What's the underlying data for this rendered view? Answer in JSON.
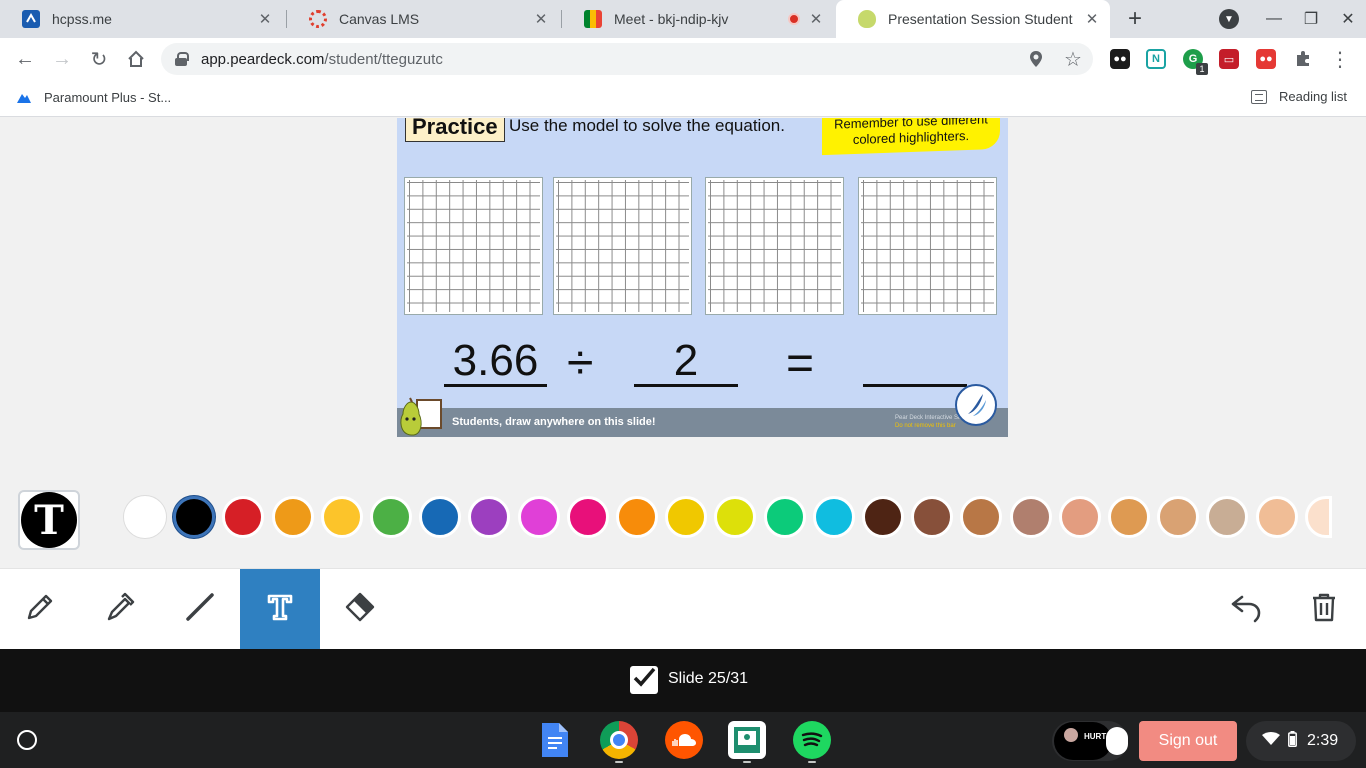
{
  "tabs": [
    {
      "title": "hcpss.me"
    },
    {
      "title": "Canvas LMS"
    },
    {
      "title": "Meet - bkj-ndip-kjv"
    },
    {
      "title": "Presentation Session Student"
    }
  ],
  "address": {
    "host": "app.peardeck.com",
    "path": "/student/tteguzutc"
  },
  "bookmarks": {
    "item": "Paramount Plus - St...",
    "reading_list": "Reading list"
  },
  "extensions": {
    "badge": "1"
  },
  "slide": {
    "practice_label": "Practice",
    "instruction": "Use the model to solve the equation.",
    "note_line1": "Remember to use different",
    "note_line2": "colored highlighters.",
    "dividend": "3.66",
    "operator": "÷",
    "divisor": "2",
    "equals": "=",
    "answer": "",
    "footer_text": "Students, draw anywhere on this slide!",
    "footer_small1": "Pear Deck Interactive Slide",
    "footer_small2": "Do not remove this bar"
  },
  "colors": [
    "#ffffff",
    "#000000",
    "#d61f26",
    "#ee9a18",
    "#fcc42a",
    "#4cb045",
    "#1769b5",
    "#9c3fbf",
    "#e040d7",
    "#e8107a",
    "#f78c0a",
    "#f0c800",
    "#dde00a",
    "#0ccb7a",
    "#10bde0",
    "#4e2414",
    "#87503a",
    "#b87746",
    "#b07f6e",
    "#e39d80",
    "#de9a52",
    "#d9a273",
    "#c8ad95",
    "#f0bd96",
    "#fbe0cc"
  ],
  "selected_color_index": 1,
  "status": {
    "slide_label": "Slide 25/31"
  },
  "shelf": {
    "sign_out": "Sign out",
    "time": "2:39",
    "avatar_text": "HURT"
  }
}
